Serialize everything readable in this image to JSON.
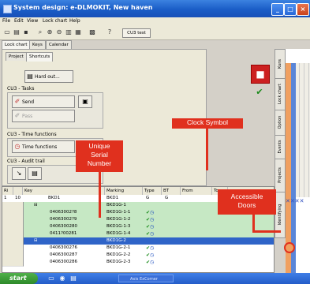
{
  "window": {
    "title": "System design: e-DLMOKIT, New haven"
  },
  "menu": [
    "File",
    "Edit",
    "View",
    "Lock chart",
    "Help"
  ],
  "toolbar": {
    "text_button": "CU3 test"
  },
  "top_tabs": [
    "Lock chart",
    "Keys",
    "Calendar"
  ],
  "sub_tabs": [
    "Project",
    "Shortcuts"
  ],
  "panel": {
    "hard_out_label": "Hard out...",
    "tasks_group": "CU3 - Tasks",
    "send_label": "Send",
    "pass_label": "Pass",
    "time_group": "CU3 - Time functions",
    "time_functions_label": "Time functions",
    "audit_group": "CU3 - Audit trail"
  },
  "side_tabs": [
    "Kuns",
    "Lock chart",
    "Option",
    "Events",
    "Projects",
    "Identifying"
  ],
  "table": {
    "headers": [
      "Ri",
      "",
      "Key",
      "Marking",
      "Type",
      "BT",
      "From",
      "To"
    ],
    "first_row": {
      "num": "1",
      "flag": "10",
      "key": "BKD1",
      "marking": "BKD1",
      "type": "G",
      "bt": "G",
      "value": "4"
    },
    "rows": [
      {
        "style": "green",
        "expand": "⊟",
        "key": "",
        "marking": "BKD1G-1",
        "type": ""
      },
      {
        "style": "green",
        "expand": "",
        "key": "04063002?8",
        "marking": "BKD1G-1-1",
        "type": "ok"
      },
      {
        "style": "green",
        "expand": "",
        "key": "04063002?9",
        "marking": "BKD1G-1-2",
        "type": "ok"
      },
      {
        "style": "green",
        "expand": "",
        "key": "0406300280",
        "marking": "BKD1G-1-3",
        "type": "ok"
      },
      {
        "style": "green",
        "expand": "",
        "key": "0411?00281",
        "marking": "BKD1G-1-4",
        "type": "ok"
      },
      {
        "style": "sel",
        "expand": "⊟",
        "key": "",
        "marking": "BKD1G-2",
        "type": ""
      },
      {
        "style": "white",
        "expand": "",
        "key": "0406300276",
        "marking": "BKD1G-2-1",
        "type": "ok"
      },
      {
        "style": "white",
        "expand": "",
        "key": "0406300287",
        "marking": "BKD1G-2-2",
        "type": "ok"
      },
      {
        "style": "white",
        "expand": "",
        "key": "0406300286",
        "marking": "BKD1G-2-3",
        "type": "ok"
      }
    ]
  },
  "callouts": {
    "clock": "Clock Symbol",
    "serial": [
      "Unique",
      "Serial",
      "Number"
    ],
    "doors": [
      "Accessible",
      "Doors"
    ]
  },
  "taskbar": {
    "start": "start",
    "item": "Axis ExCorner"
  },
  "colors": {
    "callout": "#e0301e",
    "titlebar": "#1a5dc7",
    "row_green": "#c6e8c4",
    "row_selected": "#2f64c8"
  }
}
